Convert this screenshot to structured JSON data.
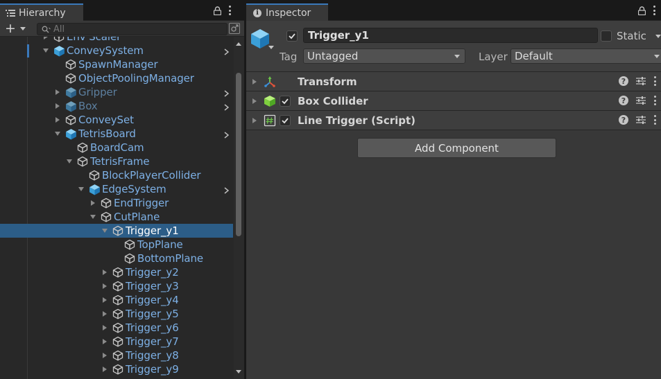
{
  "hierarchy": {
    "tab_label": "Hierarchy",
    "search": {
      "placeholder": "All",
      "value": ""
    },
    "items": [
      {
        "label": "Env Scaler",
        "depth": 0,
        "expand": "collapsed",
        "icon": "gameobject-icon",
        "dim": false,
        "more": false,
        "selected": false
      },
      {
        "label": "ConveySystem",
        "depth": 0,
        "expand": "expanded",
        "icon": "prefab-icon",
        "dim": false,
        "more": true,
        "selected": false
      },
      {
        "label": "SpawnManager",
        "depth": 1,
        "expand": "none",
        "icon": "gameobject-icon",
        "dim": false,
        "more": false,
        "selected": false
      },
      {
        "label": "ObjectPoolingManager",
        "depth": 1,
        "expand": "none",
        "icon": "gameobject-icon",
        "dim": false,
        "more": false,
        "selected": false
      },
      {
        "label": "Gripper",
        "depth": 1,
        "expand": "collapsed",
        "icon": "prefab-icon",
        "dim": true,
        "more": true,
        "selected": false
      },
      {
        "label": "Box",
        "depth": 1,
        "expand": "collapsed",
        "icon": "prefab-icon",
        "dim": true,
        "more": true,
        "selected": false
      },
      {
        "label": "ConveySet",
        "depth": 1,
        "expand": "collapsed",
        "icon": "gameobject-icon",
        "dim": false,
        "more": false,
        "selected": false
      },
      {
        "label": "TetrisBoard",
        "depth": 1,
        "expand": "expanded",
        "icon": "prefab-icon",
        "dim": false,
        "more": true,
        "selected": false
      },
      {
        "label": "BoardCam",
        "depth": 2,
        "expand": "none",
        "icon": "gameobject-icon",
        "dim": false,
        "more": false,
        "selected": false
      },
      {
        "label": "TetrisFrame",
        "depth": 2,
        "expand": "expanded",
        "icon": "gameobject-icon",
        "dim": false,
        "more": false,
        "selected": false
      },
      {
        "label": "BlockPlayerCollider",
        "depth": 3,
        "expand": "none",
        "icon": "gameobject-icon",
        "dim": false,
        "more": false,
        "selected": false
      },
      {
        "label": "EdgeSystem",
        "depth": 3,
        "expand": "expanded",
        "icon": "prefab-icon",
        "dim": false,
        "more": true,
        "selected": false
      },
      {
        "label": "EndTrigger",
        "depth": 4,
        "expand": "collapsed",
        "icon": "gameobject-icon",
        "dim": false,
        "more": false,
        "selected": false
      },
      {
        "label": "CutPlane",
        "depth": 4,
        "expand": "expanded",
        "icon": "gameobject-icon",
        "dim": false,
        "more": false,
        "selected": false
      },
      {
        "label": "Trigger_y1",
        "depth": 5,
        "expand": "expanded",
        "icon": "gameobject-icon",
        "dim": false,
        "more": false,
        "selected": true
      },
      {
        "label": "TopPlane",
        "depth": 6,
        "expand": "none",
        "icon": "gameobject-icon",
        "dim": false,
        "more": false,
        "selected": false
      },
      {
        "label": "BottomPlane",
        "depth": 6,
        "expand": "none",
        "icon": "gameobject-icon",
        "dim": false,
        "more": false,
        "selected": false
      },
      {
        "label": "Trigger_y2",
        "depth": 5,
        "expand": "collapsed",
        "icon": "gameobject-icon",
        "dim": false,
        "more": false,
        "selected": false
      },
      {
        "label": "Trigger_y3",
        "depth": 5,
        "expand": "collapsed",
        "icon": "gameobject-icon",
        "dim": false,
        "more": false,
        "selected": false
      },
      {
        "label": "Trigger_y4",
        "depth": 5,
        "expand": "collapsed",
        "icon": "gameobject-icon",
        "dim": false,
        "more": false,
        "selected": false
      },
      {
        "label": "Trigger_y5",
        "depth": 5,
        "expand": "collapsed",
        "icon": "gameobject-icon",
        "dim": false,
        "more": false,
        "selected": false
      },
      {
        "label": "Trigger_y6",
        "depth": 5,
        "expand": "collapsed",
        "icon": "gameobject-icon",
        "dim": false,
        "more": false,
        "selected": false
      },
      {
        "label": "Trigger_y7",
        "depth": 5,
        "expand": "collapsed",
        "icon": "gameobject-icon",
        "dim": false,
        "more": false,
        "selected": false
      },
      {
        "label": "Trigger_y8",
        "depth": 5,
        "expand": "collapsed",
        "icon": "gameobject-icon",
        "dim": false,
        "more": false,
        "selected": false
      },
      {
        "label": "Trigger_y9",
        "depth": 5,
        "expand": "collapsed",
        "icon": "gameobject-icon",
        "dim": false,
        "more": false,
        "selected": false
      }
    ]
  },
  "inspector": {
    "tab_label": "Inspector",
    "object": {
      "name": "Trigger_y1",
      "active": true,
      "static_label": "Static",
      "static": false,
      "tag_label": "Tag",
      "tag_value": "Untagged",
      "layer_label": "Layer",
      "layer_value": "Default"
    },
    "components": [
      {
        "title": "Transform",
        "icon": "transform-icon",
        "has_checkbox": false,
        "enabled": true
      },
      {
        "title": "Box Collider",
        "icon": "box-collider-icon",
        "has_checkbox": true,
        "enabled": true
      },
      {
        "title": "Line Trigger (Script)",
        "icon": "script-icon",
        "has_checkbox": true,
        "enabled": true
      }
    ],
    "add_component_label": "Add Component"
  },
  "colors": {
    "selection": "#2c5d87",
    "label": "#7db0e5",
    "label_dim": "#5c7f9f",
    "tab_accent": "#3a79bb"
  }
}
